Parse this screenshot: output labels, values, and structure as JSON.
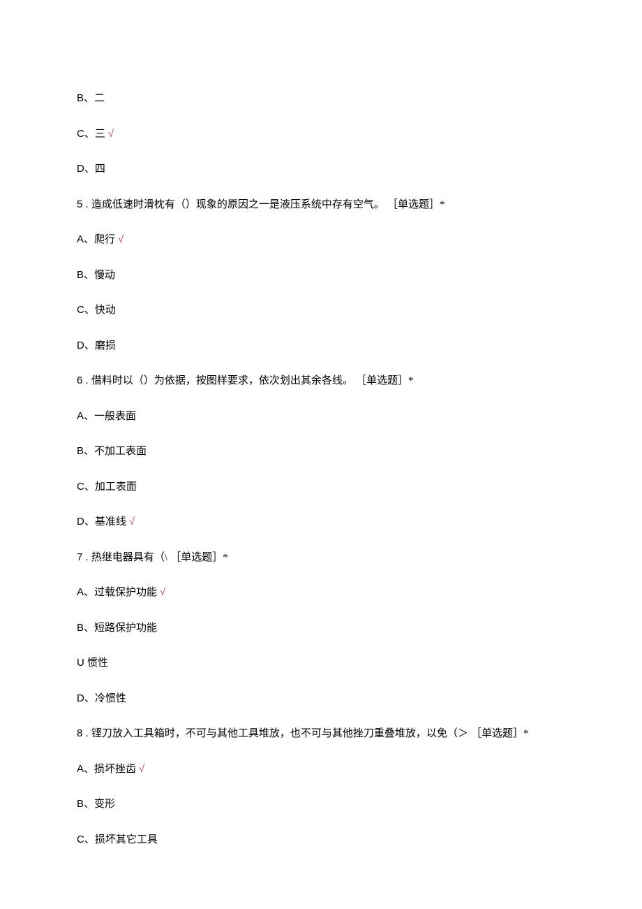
{
  "q4": {
    "options": [
      {
        "label": "B、",
        "text": "二",
        "correct": false
      },
      {
        "label": "C、",
        "text": "三",
        "correct": true
      },
      {
        "label": "D、",
        "text": "四",
        "correct": false
      }
    ]
  },
  "q5": {
    "number": "5",
    "sep": ".",
    "text": "造成低速时滑枕有（）现象的原因之一是液压系统中存有空气。",
    "tag": "［单选题］*",
    "options": [
      {
        "label": "A、",
        "text": "爬行",
        "correct": true
      },
      {
        "label": "B、",
        "text": "慢动",
        "correct": false
      },
      {
        "label": "C、",
        "text": "快动",
        "correct": false
      },
      {
        "label": "D、",
        "text": "磨损",
        "correct": false
      }
    ]
  },
  "q6": {
    "number": "6",
    "sep": ".",
    "text": "借料时以（）为依据，按图样要求，依次划出其余各线。",
    "tag": "［单选题］*",
    "options": [
      {
        "label": "A、",
        "text": "一般表面",
        "correct": false
      },
      {
        "label": "B、",
        "text": "不加工表面",
        "correct": false
      },
      {
        "label": "C、",
        "text": "加工表面",
        "correct": false
      },
      {
        "label": "D、",
        "text": "基准线",
        "correct": true
      }
    ]
  },
  "q7": {
    "number": "7",
    "sep": ".",
    "text": "热继电器具有（\\",
    "tag": "［单选题］*",
    "options": [
      {
        "label": "A、",
        "text": "过载保护功能",
        "correct": true
      },
      {
        "label": "B、",
        "text": "短路保护功能",
        "correct": false
      },
      {
        "label": "U ",
        "text": "惯性",
        "correct": false
      },
      {
        "label": "D、",
        "text": "冷惯性",
        "correct": false
      }
    ]
  },
  "q8": {
    "number": "8",
    "sep": ".",
    "text": "铿刀放入工具箱时，不可与其他工具堆放，也不可与其他挫刀重叠堆放，以免（＞",
    "tag": "［单选题］*",
    "options": [
      {
        "label": "A、",
        "text": "损坏挫齿",
        "correct": true
      },
      {
        "label": "B、",
        "text": "变形",
        "correct": false
      },
      {
        "label": "C、",
        "text": "损坏其它工具",
        "correct": false
      }
    ]
  },
  "checkmark": "√"
}
